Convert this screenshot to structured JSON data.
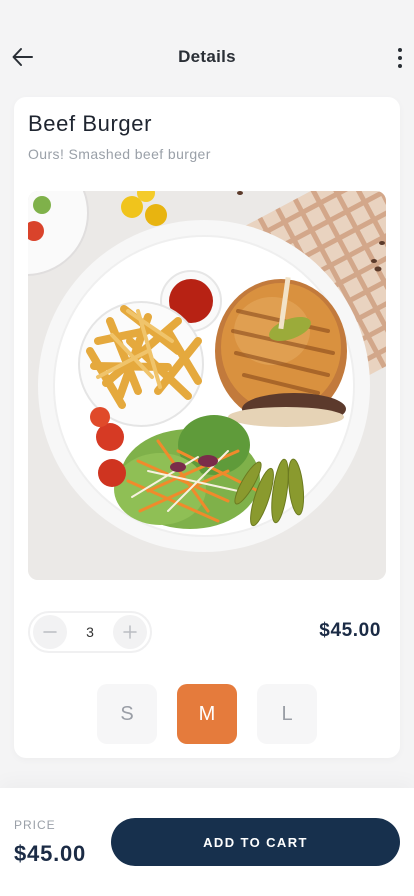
{
  "header": {
    "title": "Details",
    "back_icon": "arrow-left-icon",
    "more_icon": "more-vertical-icon"
  },
  "product": {
    "name": "Beef Burger",
    "description": "Ours! Smashed beef burger",
    "image": "burger-fries-salad-plate-photo"
  },
  "quantity": {
    "value": "3",
    "decrement_icon": "minus-icon",
    "increment_icon": "plus-icon"
  },
  "price": "$45.00",
  "sizes": {
    "options": [
      "S",
      "M",
      "L"
    ],
    "selected": "M"
  },
  "footer": {
    "price_label": "PRICE",
    "price_value": "$45.00",
    "cta_label": "ADD TO CART"
  },
  "colors": {
    "accent": "#e57b3c",
    "primary": "#17304d",
    "price_text": "#1b2b45"
  }
}
